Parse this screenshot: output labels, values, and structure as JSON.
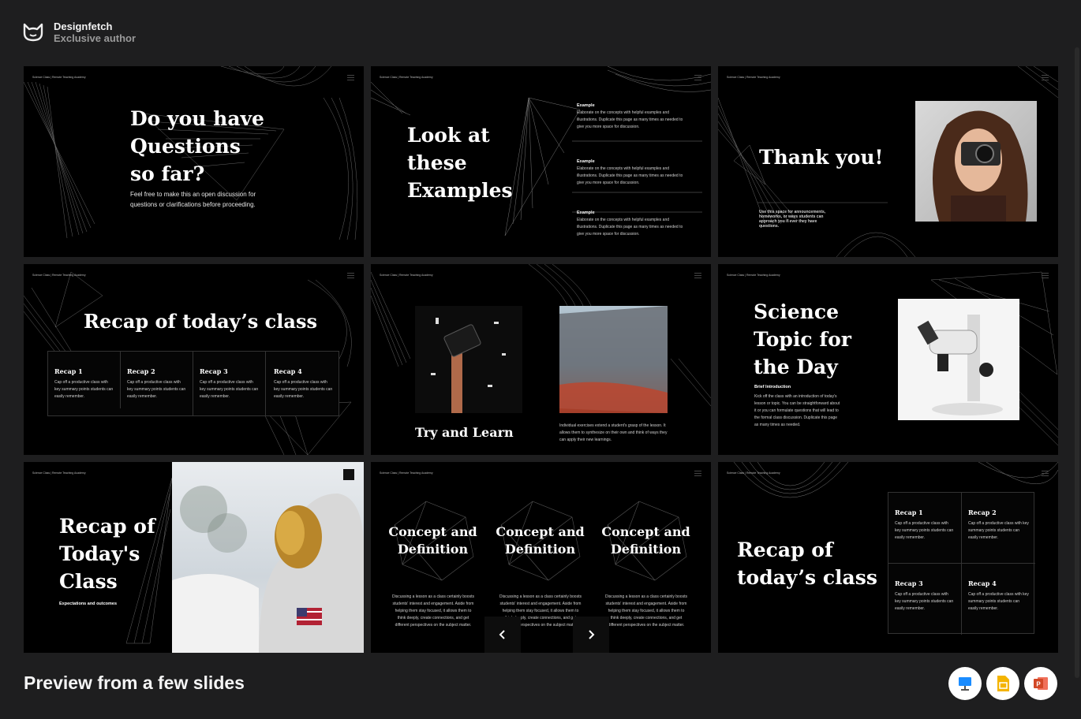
{
  "header": {
    "brand_name": "Designfetch",
    "brand_sub": "Exclusive author",
    "logo_icon": "cat-face-icon"
  },
  "slide_header": "Science Class | Remote Teaching Academy",
  "slides": {
    "s1": {
      "title_lines": [
        "Do you have",
        "Questions",
        "so far?"
      ],
      "body": "Feel free to make this an open discussion for questions or clarifications before proceeding."
    },
    "s2": {
      "title_lines": [
        "Look at",
        "these",
        "Examples"
      ],
      "examples": [
        {
          "label": "Example",
          "text": "Elaborate on the concepts with helpful examples and illustrations. Duplicate this page as many times as needed to give you more space for discussion."
        },
        {
          "label": "Example",
          "text": "Elaborate on the concepts with helpful examples and illustrations. Duplicate this page as many times as needed to give you more space for discussion."
        },
        {
          "label": "Example",
          "text": "Elaborate on the concepts with helpful examples and illustrations. Duplicate this page as many times as needed to give you more space for discussion."
        }
      ]
    },
    "s3": {
      "title": "Thank you!",
      "body": "Use this space for announcements, homeworks, or ways students can approach you if ever they have questions."
    },
    "s4": {
      "title": "Recap of today’s class",
      "cells": [
        {
          "title": "Recap 1",
          "text": "Cap off a productive class with key summary points students can easily remember."
        },
        {
          "title": "Recap 2",
          "text": "Cap off a productive class with key summary points students can easily remember."
        },
        {
          "title": "Recap 3",
          "text": "Cap off a productive class with key summary points students can easily remember."
        },
        {
          "title": "Recap 4",
          "text": "Cap off a productive class with key summary points students can easily remember."
        }
      ]
    },
    "s5": {
      "title": "Try and Learn",
      "body": "Individual exercises extend a student's grasp of the lesson. It allows them to synthesize on their own and think of ways they can apply their new learnings."
    },
    "s6": {
      "title_lines": [
        "Science",
        "Topic for",
        "the Day"
      ],
      "sub": "Brief Introduction",
      "body": "Kick off the class with an introduction of today's lesson or topic. You can be straightforward about it or you can formulate questions that will lead to the formal class discussion. Duplicate this page as many times as needed."
    },
    "s7": {
      "title_lines": [
        "Recap of",
        "Today's",
        "Class"
      ],
      "sub": "Expectations and outcomes"
    },
    "s8": {
      "columns": [
        {
          "title_lines": [
            "Concept and",
            "Definition"
          ],
          "text": "Discussing a lesson as a class certainly boosts students' interest and engagement. Aside from helping them stay focused, it allows them to think deeply, create connections, and get different perspectives on the subject matter."
        },
        {
          "title_lines": [
            "Concept and",
            "Definition"
          ],
          "text": "Discussing a lesson as a class certainly boosts students' interest and engagement. Aside from helping them stay focused, it allows them to think deeply, create connections, and get different perspectives on the subject matter."
        },
        {
          "title_lines": [
            "Concept and",
            "Definition"
          ],
          "text": "Discussing a lesson as a class certainly boosts students' interest and engagement. Aside from helping them stay focused, it allows them to think deeply, create connections, and get different perspectives on the subject matter."
        }
      ]
    },
    "s9": {
      "title_lines": [
        "Recap of",
        "today’s class"
      ],
      "cells": [
        {
          "title": "Recap 1",
          "text": "Cap off a productive class with key summary points students can easily remember."
        },
        {
          "title": "Recap 2",
          "text": "Cap off a productive class with key summary points students can easily remember."
        },
        {
          "title": "Recap 3",
          "text": "Cap off a productive class with key summary points students can easily remember."
        },
        {
          "title": "Recap 4",
          "text": "Cap off a productive class with key summary points students can easily remember."
        }
      ]
    }
  },
  "carousel": {
    "prev_icon": "chevron-left-icon",
    "next_icon": "chevron-right-icon"
  },
  "footer": {
    "title": "Preview from a few slides",
    "apps": [
      {
        "icon": "keynote-icon",
        "color": "#1a8cff"
      },
      {
        "icon": "google-slides-icon",
        "color": "#f4b400"
      },
      {
        "icon": "powerpoint-icon",
        "color": "#d24726"
      }
    ]
  }
}
